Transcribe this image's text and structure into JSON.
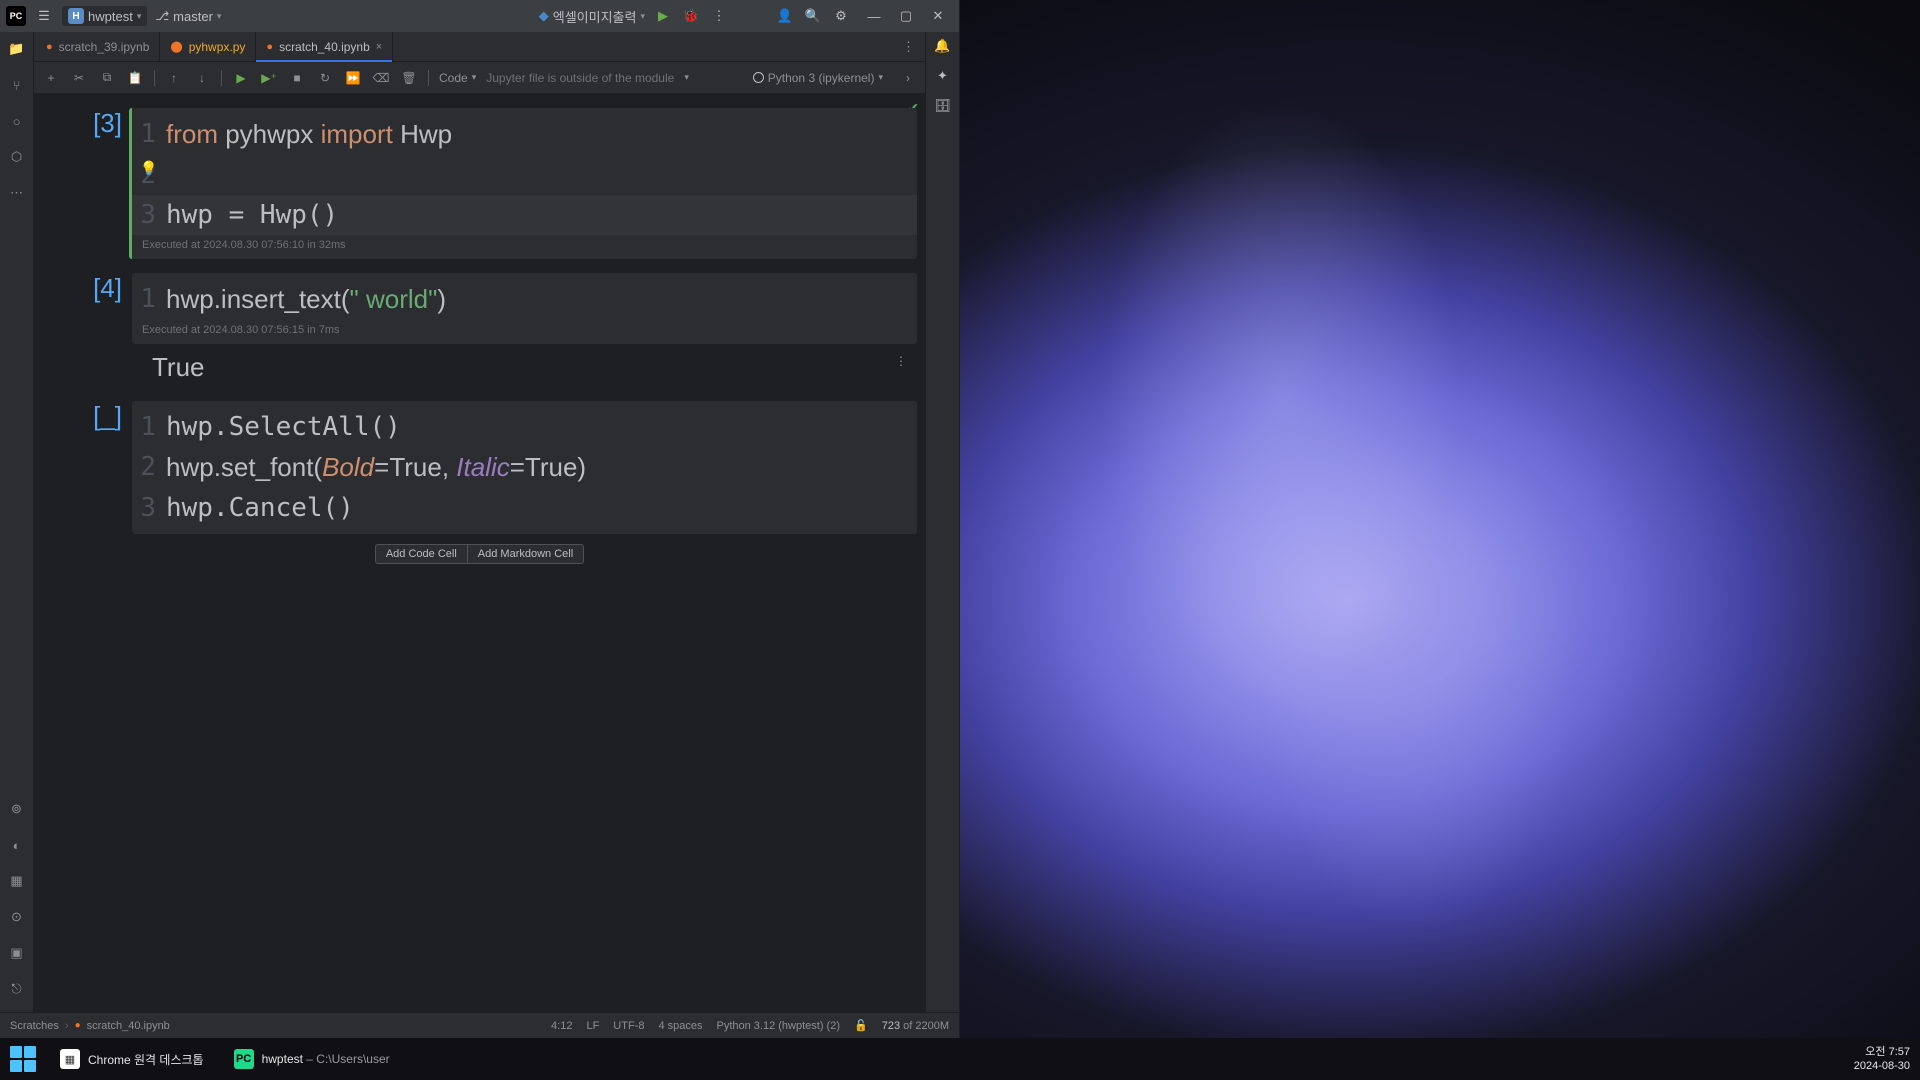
{
  "titlebar": {
    "project_letter": "H",
    "project_name": "hwptest",
    "branch_name": "master",
    "run_config": "엑셀이미지출력"
  },
  "file_tabs": {
    "tab1": "scratch_39.ipynb",
    "tab2": "pyhwpx.py",
    "tab3": "scratch_40.ipynb"
  },
  "nb_toolbar": {
    "code_label": "Code",
    "notice": "Jupyter file is outside of the module",
    "kernel": "Python 3 (ipykernel)"
  },
  "cells": {
    "c1": {
      "exec": "[3]",
      "ln1": "1",
      "ln2": "2",
      "ln3": "3",
      "code1a": "from",
      "code1b": " pyhwpx ",
      "code1c": "import",
      "code1d": " Hwp",
      "code3": "hwp = Hwp()",
      "meta": "Executed at 2024.08.30 07:56:10 in 32ms"
    },
    "c2": {
      "exec": "[4]",
      "ln1": "1",
      "code_pre": "hwp.insert_text(",
      "code_str": "\" world\"",
      "code_post": ")",
      "meta": "Executed at 2024.08.30 07:56:15 in 7ms",
      "output": "True"
    },
    "c3": {
      "exec": "[_]",
      "ln1": "1",
      "ln2": "2",
      "ln3": "3",
      "r1": "hwp.SelectAll()",
      "r2a": "hwp.set_font(",
      "r2b": "Bold",
      "r2c": "=True, ",
      "r2d": "Italic",
      "r2e": "=True)",
      "r3": "hwp.Cancel()"
    }
  },
  "add_cell": {
    "code": "Add Code Cell",
    "md": "Add Markdown Cell"
  },
  "statusbar": {
    "crumb1": "Scratches",
    "crumb2": "scratch_40.ipynb",
    "pos": "4:12",
    "eol": "LF",
    "enc": "UTF-8",
    "indent": "4 spaces",
    "interp": "Python 3.12 (hwptest) (2)",
    "mem_used": "723",
    "mem_of": " of 2200M"
  },
  "taskbar": {
    "task1": "Chrome 원격 데스크톱",
    "task2_app": "hwptest",
    "task2_path": " – C:\\Users\\user",
    "time": "오전 7:57",
    "date": "2024-08-30"
  }
}
